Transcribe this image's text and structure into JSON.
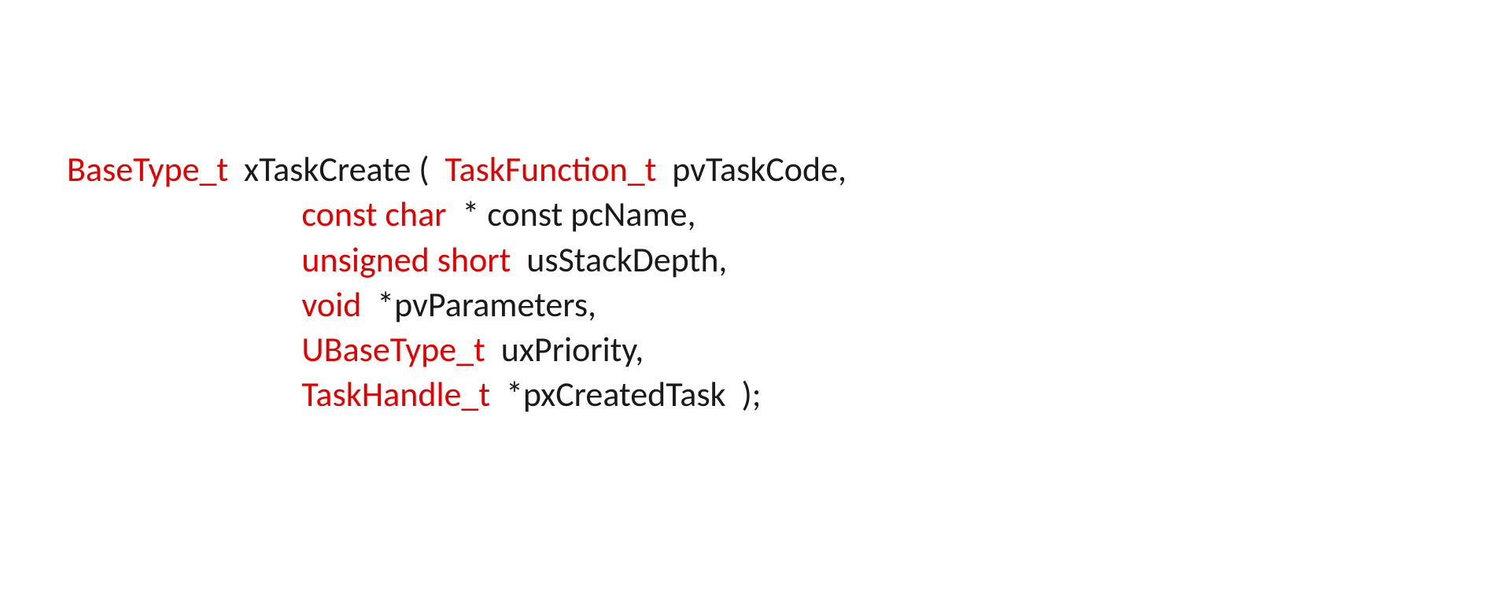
{
  "signature": {
    "returnType": "BaseType_t",
    "funcName": "xTaskCreate",
    "params": [
      {
        "type": "TaskFunction_t",
        "name": "pvTaskCode,"
      },
      {
        "type": "const char ",
        "ptr": "* ",
        "const2": "const ",
        "name": "pcName,"
      },
      {
        "type": "unsigned short",
        "name": "usStackDepth,"
      },
      {
        "type": "void ",
        "ptr": "*",
        "name": "pvParameters,"
      },
      {
        "type": "UBaseType_t",
        "name": "uxPriority,"
      },
      {
        "type": "TaskHandle_t ",
        "ptr": "*",
        "name": "pxCreatedTask  );"
      }
    ]
  }
}
